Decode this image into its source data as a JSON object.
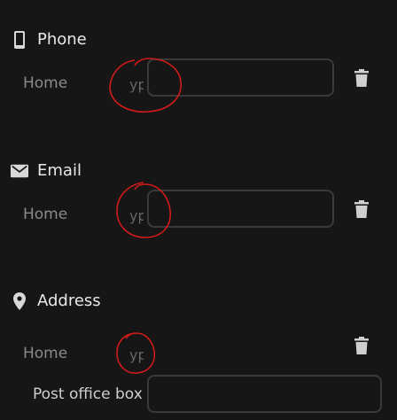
{
  "sections": [
    {
      "icon": "phone-icon",
      "title": "Phone",
      "label": "Home",
      "type_text": "yp",
      "value": ""
    },
    {
      "icon": "mail-icon",
      "title": "Email",
      "label": "Home",
      "type_text": "yp",
      "value": ""
    },
    {
      "icon": "location-pin-icon",
      "title": "Address",
      "label": "Home",
      "type_text": "yp",
      "po_box_label": "Post office box",
      "po_box_value": ""
    }
  ],
  "colors": {
    "background": "#161616",
    "border": "#3a3a3a",
    "annotation": "#d11a1a"
  }
}
